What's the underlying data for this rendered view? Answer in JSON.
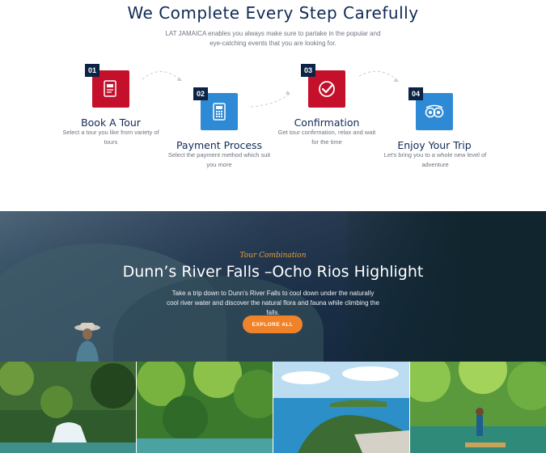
{
  "section": {
    "title": "We Complete Every Step Carefully",
    "subtitle": "LAT JAMAICA enables you always make sure to partake in the popular and eye-catching events that you are looking for."
  },
  "steps": [
    {
      "number": "01",
      "title": "Book A Tour",
      "description": "Select a tour you like from variety of tours",
      "icon": "document-icon",
      "color": "#c4102a"
    },
    {
      "number": "02",
      "title": "Payment Process",
      "description": "Select the payment method which suit you more",
      "icon": "calculator-icon",
      "color": "#2f8ad6"
    },
    {
      "number": "03",
      "title": "Confirmation",
      "description": "Get tour confirmation, relax and wait for the time",
      "icon": "check-badge-icon",
      "color": "#c4102a"
    },
    {
      "number": "04",
      "title": "Enjoy Your Trip",
      "description": "Let's bring you to a whole new level of adventure",
      "icon": "tripadvisor-owl-icon",
      "color": "#2f8ad6"
    }
  ],
  "hero": {
    "kicker": "Tour Combination",
    "title": "Dunn’s River Falls –Ocho Rios Highlight",
    "description": "Take a trip down to Dunn's River Falls to cool down under the naturally cool river water and discover the natural flora and fauna while climbing the falls.",
    "button_label": "EXPLORE ALL",
    "button_color": "#f0832a"
  },
  "gallery": [
    "waterfall-photo",
    "jungle-river-photo",
    "coastal-town-photo",
    "bamboo-rafting-photo"
  ]
}
